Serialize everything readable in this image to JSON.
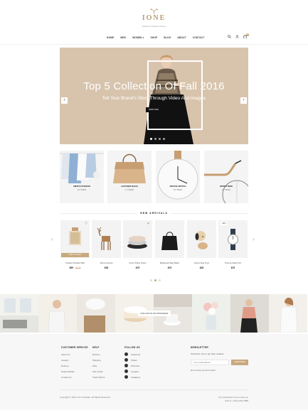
{
  "header": {
    "logo": "IONE",
    "tagline": "Fashion Furniture Theme",
    "nav": [
      "HOME",
      "MEN",
      "WOMEN",
      "SHOP",
      "BLOG",
      "ABOUT",
      "CONTACT"
    ],
    "cart_count": "0"
  },
  "hero": {
    "title": "Top 5 Collection Of Fall 2016",
    "subtitle": "Tell Your Brand's Story Through Video And Images",
    "button": "SHOP NOW"
  },
  "categories": [
    {
      "label": "MEN'S FASHION",
      "count": "16 ITEMS"
    },
    {
      "label": "LEATHER BAGS",
      "count": "17 ITEMS"
    },
    {
      "label": "DEVICE WATCH",
      "count": "16 ITEMS"
    },
    {
      "label": "SPORT BIKE",
      "count": "12 ITEMS"
    }
  ],
  "arrivals": {
    "title": "NEW ARRIVALS",
    "add_to_cart": "ADD TO CART",
    "products": [
      {
        "name": "Chiara Perillara 008",
        "price": "$99",
        "old_price": "$120",
        "badge": ""
      },
      {
        "name": "Wood Animal",
        "price": "$35",
        "old_price": "",
        "badge": ""
      },
      {
        "name": "Color Pillow Sham",
        "price": "$79",
        "old_price": "",
        "badge": ""
      },
      {
        "name": "Backpack Bag Black",
        "price": "$79",
        "old_price": "",
        "badge": ""
      },
      {
        "name": "Wood Dog Toys",
        "price": "$25",
        "old_price": "",
        "badge": ""
      },
      {
        "name": "Prisma Watch 05",
        "price": "$79",
        "old_price": "",
        "badge": "-10%"
      }
    ]
  },
  "instagram": {
    "follow_label": "FOLLOW US ON INSTAGRAM"
  },
  "footer": {
    "customer_service": {
      "title": "CUSTOMER SERVICE",
      "links": [
        "About Us",
        "Careers",
        "Delivery",
        "Responsibility",
        "Contact Us"
      ]
    },
    "help": {
      "title": "HELP",
      "links": [
        "Returns",
        "Shipping",
        "FAQ",
        "Size Guide",
        "Track Orders"
      ]
    },
    "follow": {
      "title": "FOLLOW US",
      "links": [
        "Facebook",
        "Twitter",
        "Pinterest",
        "Google+",
        "Instagram"
      ]
    },
    "newsletter": {
      "title": "NEWSLETTER",
      "text": "Subscribe now to get daily updates",
      "placeholder": "Your email address",
      "button": "SUBSCRIBE",
      "note": "Don't worry we don't spam"
    },
    "copyright": "Copyright © 2016. Our Template. All Rights Reserved",
    "contact_line1": "Any questions? Let us help you",
    "contact_line2": "Call us: (+84) 1234 4888"
  },
  "colors": {
    "accent": "#c8a97e",
    "hero_bg": "#d8c4ad",
    "dark": "#111111"
  }
}
